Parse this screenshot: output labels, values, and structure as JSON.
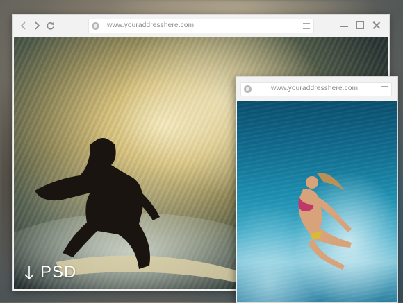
{
  "main_window": {
    "address": "www.youraddresshere.com",
    "nav_icons": [
      "back-arrow-icon",
      "forward-arrow-icon",
      "reload-icon"
    ],
    "window_controls": [
      "minimize-icon",
      "maximize-icon",
      "close-icon"
    ],
    "photo_label": "PSD"
  },
  "small_window": {
    "address": "www.youraddresshere.com"
  },
  "colors": {
    "chrome": "#f4f4f4",
    "icon_gray": "#8a8a8a",
    "url_text": "#8a8a8a"
  }
}
